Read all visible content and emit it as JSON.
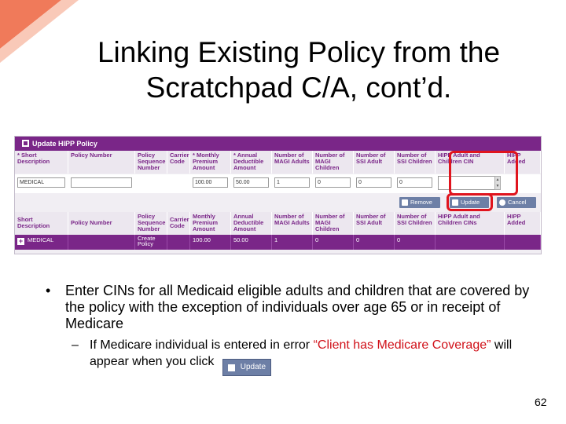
{
  "slide": {
    "title_line1": "Linking Existing Policy from the",
    "title_line2": "Scratchpad C/A, cont’d.",
    "page_number": "62",
    "accent_color": "#e0141e",
    "corner_color": "#f07a5a"
  },
  "panel": {
    "title": "Update HIPP Policy",
    "header_color": "#7a2688",
    "edit_headers": [
      "* Short Description",
      "Policy Number",
      "Policy Sequence Number",
      "Carrier Code",
      "* Monthly Premium Amount",
      "* Annual Deductible Amount",
      "Number of MAGI Adults",
      "Number of MAGI Children",
      "Number of SSI Adult",
      "Number of SSI Children",
      "HIPP Adult and Children CIN",
      "HIPP Added"
    ],
    "inputs": {
      "short_description": "MEDICAL",
      "policy_number": "",
      "monthly_premium": "100.00",
      "annual_deductible": "50.00",
      "magi_adults": "1",
      "magi_children": "0",
      "ssi_adult": "0",
      "ssi_children": "0",
      "hipp_cin": ""
    },
    "buttons": {
      "remove": "Remove",
      "update": "Update",
      "cancel": "Cancel"
    },
    "list_headers": [
      "Short Description",
      "Policy Number",
      "Policy Sequence Number",
      "Carrier Code",
      "Monthly Premium Amount",
      "Annual Deductible Amount",
      "Number of MAGI Adults",
      "Number of MAGI Children",
      "Number of SSI Adult",
      "Number of SSI Children",
      "HIPP Adult and Children CINs",
      "HIPP Added"
    ],
    "row": {
      "short_description": "MEDICAL",
      "policy_number": "",
      "sequence": "Create Policy",
      "carrier": "",
      "monthly_premium": "100.00",
      "annual_deductible": "50.00",
      "magi_adults": "1",
      "magi_children": "0",
      "ssi_adult": "0",
      "ssi_children": "0",
      "cins": "",
      "added": ""
    }
  },
  "body": {
    "bullet1": "Enter CINs for all Medicaid eligible adults and children that are covered by the policy with the exception of individuals over age 65 or in receipt of Medicare",
    "sub_before": "If Medicare individual is entered in error ",
    "sub_red": "“Client has Medicare Coverage”",
    "sub_after": " will appear when you click",
    "inline_button": "Update"
  }
}
